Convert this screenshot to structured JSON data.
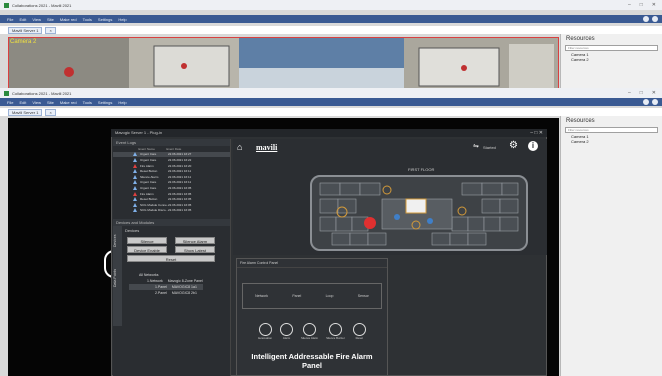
{
  "top_window": {
    "title": "Collaborations 2021 - Mavili 2021",
    "menu": [
      "File",
      "Edit",
      "View",
      "Site",
      "Make red",
      "Tools",
      "Settings",
      "Help"
    ],
    "tab_label": "Mavili Server 1",
    "camera_label": "Camera 2"
  },
  "bottom_window": {
    "title": "Collaborations 2021 - Mavili 2021",
    "menu": [
      "File",
      "Edit",
      "View",
      "Site",
      "Make red",
      "Tools",
      "Settings",
      "Help"
    ],
    "tab_label": "Mavili Server 1"
  },
  "resources_top": {
    "title": "Resources",
    "search_placeholder": "Filter resources",
    "items": [
      "Camera 1",
      "Camera 2"
    ]
  },
  "resources_bottom": {
    "title": "Resources",
    "search_placeholder": "Filter resources",
    "items": [
      "Camera 1",
      "Camera 2"
    ]
  },
  "plugin": {
    "title": "Mavogic Server 1 - Plug-in",
    "brand": "mavili",
    "status_label": "Started",
    "event_log": {
      "title": "Event Logs",
      "columns": [
        "Event Name",
        "Event Date"
      ],
      "rows": [
        {
          "name": "Urgent Care",
          "date": "22.06.2021 16:27",
          "level": "info"
        },
        {
          "name": "Urgent Care",
          "date": "22.06.2021 16:22",
          "level": "info"
        },
        {
          "name": "Fire Alarm",
          "date": "22.06.2021 16:20",
          "level": "alarm"
        },
        {
          "name": "Reset Button",
          "date": "22.06.2021 16:11",
          "level": "info"
        },
        {
          "name": "Silence Alarm",
          "date": "22.06.2021 16:11",
          "level": "info"
        },
        {
          "name": "Urgent Care",
          "date": "22.06.2021 16:11",
          "level": "info"
        },
        {
          "name": "Urgent Care",
          "date": "22.06.2021 16:05",
          "level": "info"
        },
        {
          "name": "Fire Alarm",
          "date": "22.06.2021 16:05",
          "level": "alarm"
        },
        {
          "name": "Reset Button",
          "date": "22.06.2021 16:05",
          "level": "info"
        },
        {
          "name": "SCG Module Conne...",
          "date": "22.06.2021 16:05",
          "level": "info"
        },
        {
          "name": "SCG Module Disco...",
          "date": "22.06.2021 16:05",
          "level": "info"
        }
      ]
    },
    "devices_panel": {
      "title": "Devices and Modules",
      "side_tabs": [
        "Devices",
        "Data Points"
      ],
      "group": "Devices",
      "buttons": [
        "Silence",
        "Silence Alarm",
        "Device Enable",
        "Show Latest",
        "Reset"
      ],
      "tree": [
        {
          "label": "All Networks",
          "extra": ""
        },
        {
          "label": "1.Network",
          "extra": "Mavogic 8-Zone Panel"
        },
        {
          "label": "1.Panel",
          "extra": "MAVOGIC8 1a1"
        },
        {
          "label": "2.Panel",
          "extra": "MAVOGIC8 2b1"
        }
      ]
    },
    "fire_panel": {
      "title": "Fire Alarm Control Panel",
      "fields": [
        "Network",
        "Panel",
        "Loop",
        "Sensor"
      ],
      "controls": [
        "Evacuation",
        "Alarm",
        "Silence Alarm",
        "Silence Buzzer",
        "Reset"
      ],
      "caption": "Intelligent Addressable Fire Alarm Panel"
    },
    "floor_label": "FIRST FLOOR"
  }
}
